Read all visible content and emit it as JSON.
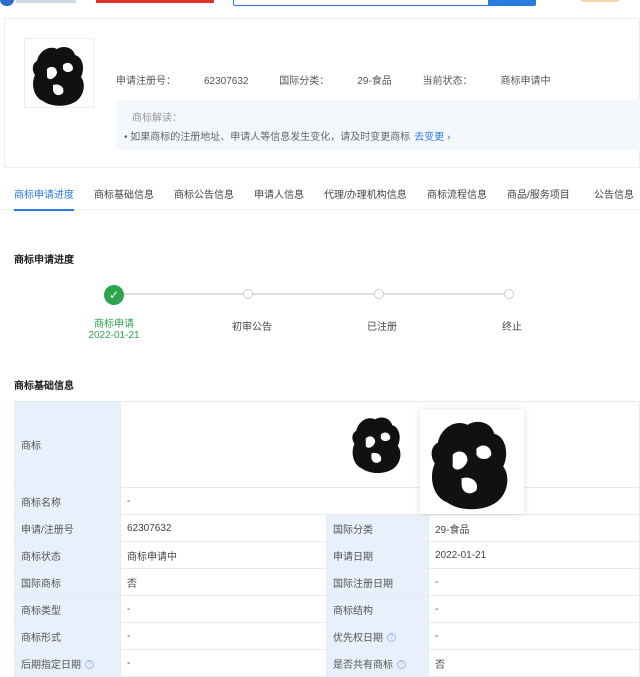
{
  "header": {
    "reg_no_label": "申请注册号：",
    "reg_no": "62307632",
    "class_label": "国际分类：",
    "class_value": "29-食品",
    "status_label": "当前状态：",
    "status_value": "商标申请中",
    "notice_title": "商标解读：",
    "notice_body": "如果商标的注册地址、申请人等信息发生变化，请及时变更商标",
    "notice_link": "去变更 ›"
  },
  "tabs": [
    {
      "label": "商标申请进度",
      "active": true
    },
    {
      "label": "商标基础信息"
    },
    {
      "label": "商标公告信息"
    },
    {
      "label": "申请人信息"
    },
    {
      "label": "代理/办理机构信息"
    },
    {
      "label": "商标流程信息"
    },
    {
      "label": "商品/服务项目"
    },
    {
      "label": "公告信息"
    }
  ],
  "progress": {
    "title": "商标申请进度",
    "steps": [
      {
        "label": "商标申请",
        "date": "2022-01-21",
        "done": true
      },
      {
        "label": "初审公告"
      },
      {
        "label": "已注册"
      },
      {
        "label": "终止"
      }
    ]
  },
  "basic": {
    "title": "商标基础信息",
    "rows": {
      "trademark_label": "商标",
      "name_label": "商标名称",
      "name_value": "-",
      "regno_label": "申请/注册号",
      "regno_value": "62307632",
      "class_label": "国际分类",
      "class_value": "29-食品",
      "status_label": "商标状态",
      "status_value": "商标申请中",
      "apply_date_label": "申请日期",
      "apply_date_value": "2022-01-21",
      "intl_label": "国际商标",
      "intl_value": "否",
      "intl_date_label": "国际注册日期",
      "intl_date_value": "-",
      "type_label": "商标类型",
      "type_value": "-",
      "struct_label": "商标结构",
      "struct_value": "-",
      "form_label": "商标形式",
      "form_value": "-",
      "priority_label": "优先权日期",
      "priority_value": "-",
      "later_label": "后期指定日期",
      "later_value": "-",
      "shared_label": "是否共有商标",
      "shared_value": "否"
    }
  }
}
